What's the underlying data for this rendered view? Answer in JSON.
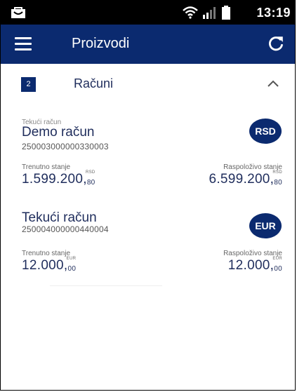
{
  "statusbar": {
    "time": "13:19"
  },
  "appbar": {
    "title": "Proizvodi"
  },
  "section": {
    "count": "2",
    "label": "Računi"
  },
  "accounts": [
    {
      "type_label": "Tekući račun",
      "name": "Demo račun",
      "number": "250003000000330003",
      "currency": "RSD",
      "current_label": "Trenutno stanje",
      "current_int": "1.599.200,",
      "current_dec": "80",
      "current_cc": "RSD",
      "available_label": "Raspoloživo stanje",
      "available_int": "6.599.200,",
      "available_dec": "80",
      "available_cc": "RSD"
    },
    {
      "name": "Tekući račun",
      "number": "250004000000440004",
      "currency": "EUR",
      "current_label": "Trenutno stanje",
      "current_int": "12.000,",
      "current_dec": "00",
      "current_cc": "EUR",
      "available_label": "Raspoloživo stanje",
      "available_int": "12.000,",
      "available_dec": "00",
      "available_cc": "EUR"
    }
  ],
  "colors": {
    "brand": "#0b2a6f",
    "text": "#1f2d5c"
  }
}
